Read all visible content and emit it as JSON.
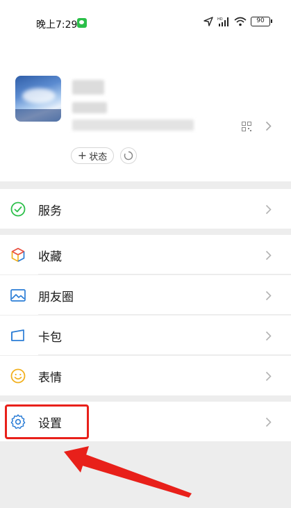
{
  "status_bar": {
    "time": "晚上7:29",
    "battery": "90"
  },
  "profile": {
    "status_button": "状态"
  },
  "menu": {
    "services": "服务",
    "favorites": "收藏",
    "moments": "朋友圈",
    "cards": "卡包",
    "stickers": "表情",
    "settings": "设置"
  },
  "colors": {
    "accent_green": "#2bbf49",
    "highlight_red": "#e8201a",
    "icon_blue": "#2b7dd6"
  }
}
